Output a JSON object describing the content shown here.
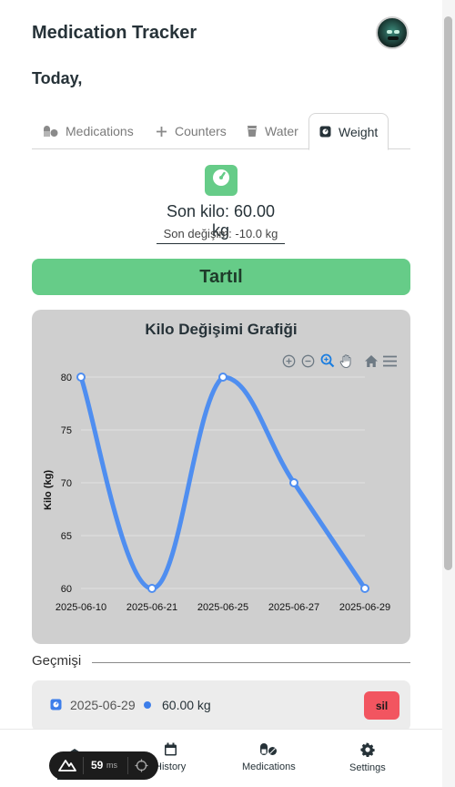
{
  "app": {
    "title": "Medication Tracker",
    "today_label": "Today,"
  },
  "tabs": [
    {
      "label": "Medications",
      "icon": "pills-icon",
      "active": false
    },
    {
      "label": "Counters",
      "icon": "plus-icon",
      "active": false
    },
    {
      "label": "Water",
      "icon": "water-glass-icon",
      "active": false
    },
    {
      "label": "Weight",
      "icon": "weight-scale-icon",
      "active": true
    }
  ],
  "weight": {
    "last_weight": "Son kilo: 60.00 kg",
    "last_change": "Son değişim: -10.0 kg",
    "weigh_button": "Tartıl",
    "accent_color": "#66cc88"
  },
  "chart_data": {
    "type": "line",
    "title": "Kilo Değişimi Grafiği",
    "ylabel": "Kilo (kg)",
    "xlabel": "",
    "categories": [
      "2025-06-10",
      "2025-06-21",
      "2025-06-25",
      "2025-06-27",
      "2025-06-29"
    ],
    "series": [
      {
        "values": [
          80,
          60,
          80,
          70,
          60
        ],
        "color": "#4f8ef0"
      }
    ],
    "ylim": [
      60,
      80
    ],
    "yticks": [
      60,
      65,
      70,
      75,
      80
    ],
    "grid": true,
    "curve": "smooth",
    "toolbar": [
      "zoom-in-icon",
      "zoom-out-icon",
      "zoom-selection-icon",
      "pan-hand-icon",
      "reset-home-icon",
      "menu-icon"
    ]
  },
  "history": {
    "label": "Geçmişi",
    "items": [
      {
        "date": "2025-06-29",
        "value": "60.00 kg",
        "delete_label": "sil"
      }
    ]
  },
  "bottom_nav": {
    "items": [
      {
        "label": "History",
        "icon": "calendar-icon"
      },
      {
        "label": "Medications",
        "icon": "pills-icon"
      },
      {
        "label": "Settings",
        "icon": "gear-icon"
      }
    ]
  },
  "perf_widget": {
    "value": "59",
    "unit": "ms"
  }
}
